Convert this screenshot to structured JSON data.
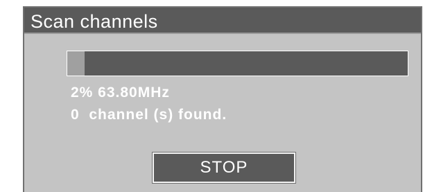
{
  "dialog": {
    "title": "Scan channels",
    "progress_fraction": 0.05,
    "status": {
      "frequency_line": "2% 63.80MHz",
      "channels_line": "0  channel (s) found."
    },
    "stop_label": "STOP"
  },
  "colors": {
    "panel": "#c4c4c4",
    "dark": "#5a5a5a",
    "progress_fill": "#a0a0a0",
    "text": "#ffffff"
  }
}
